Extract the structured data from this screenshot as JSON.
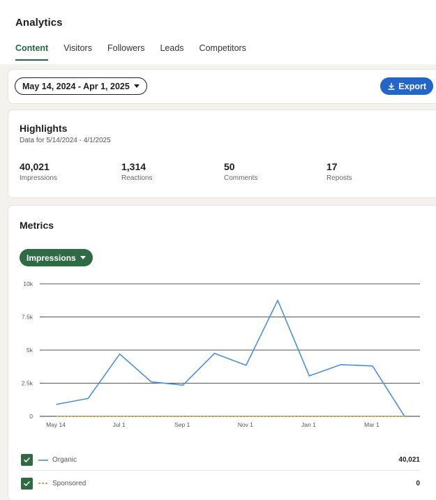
{
  "header": {
    "title": "Analytics",
    "tabs": [
      {
        "label": "Content"
      },
      {
        "label": "Visitors"
      },
      {
        "label": "Followers"
      },
      {
        "label": "Leads"
      },
      {
        "label": "Competitors"
      }
    ]
  },
  "date_range": {
    "label": "May 14, 2024 - Apr 1, 2025"
  },
  "export": {
    "label": "Export"
  },
  "highlights": {
    "title": "Highlights",
    "subtitle": "Data for 5/14/2024 - 4/1/2025",
    "stats": [
      {
        "value": "40,021",
        "label": "Impressions"
      },
      {
        "value": "1,314",
        "label": "Reactions"
      },
      {
        "value": "50",
        "label": "Comments"
      },
      {
        "value": "17",
        "label": "Reposts"
      }
    ]
  },
  "metrics": {
    "title": "Metrics",
    "metric_select": "Impressions"
  },
  "colors": {
    "organic": "#4a90d9",
    "sponsored": "#b08a2e",
    "accent_green": "#2e6b45",
    "export_blue": "#2266c9"
  },
  "chart_data": {
    "type": "line",
    "title": "",
    "xlabel": "",
    "ylabel": "",
    "ylim": [
      0,
      10000
    ],
    "yticks": [
      {
        "value": 0,
        "label": "0"
      },
      {
        "value": 2500,
        "label": "2.5k"
      },
      {
        "value": 5000,
        "label": "5k"
      },
      {
        "value": 7500,
        "label": "7.5k"
      },
      {
        "value": 10000,
        "label": "10k"
      }
    ],
    "x_ticks": [
      "May 14",
      "Jul 1",
      "Sep 1",
      "Nov 1",
      "Jan 1",
      "Mar 1"
    ],
    "grid": true,
    "legend": "bottom",
    "series": [
      {
        "name": "Organic",
        "total": "40,021",
        "style": "solid",
        "values": [
          900,
          1350,
          4700,
          2600,
          2350,
          4750,
          3850,
          8750,
          3050,
          3900,
          3800,
          50
        ]
      },
      {
        "name": "Sponsored",
        "total": "0",
        "style": "dashed",
        "values": [
          0,
          0,
          0,
          0,
          0,
          0,
          0,
          0,
          0,
          0,
          0,
          0
        ]
      }
    ]
  }
}
